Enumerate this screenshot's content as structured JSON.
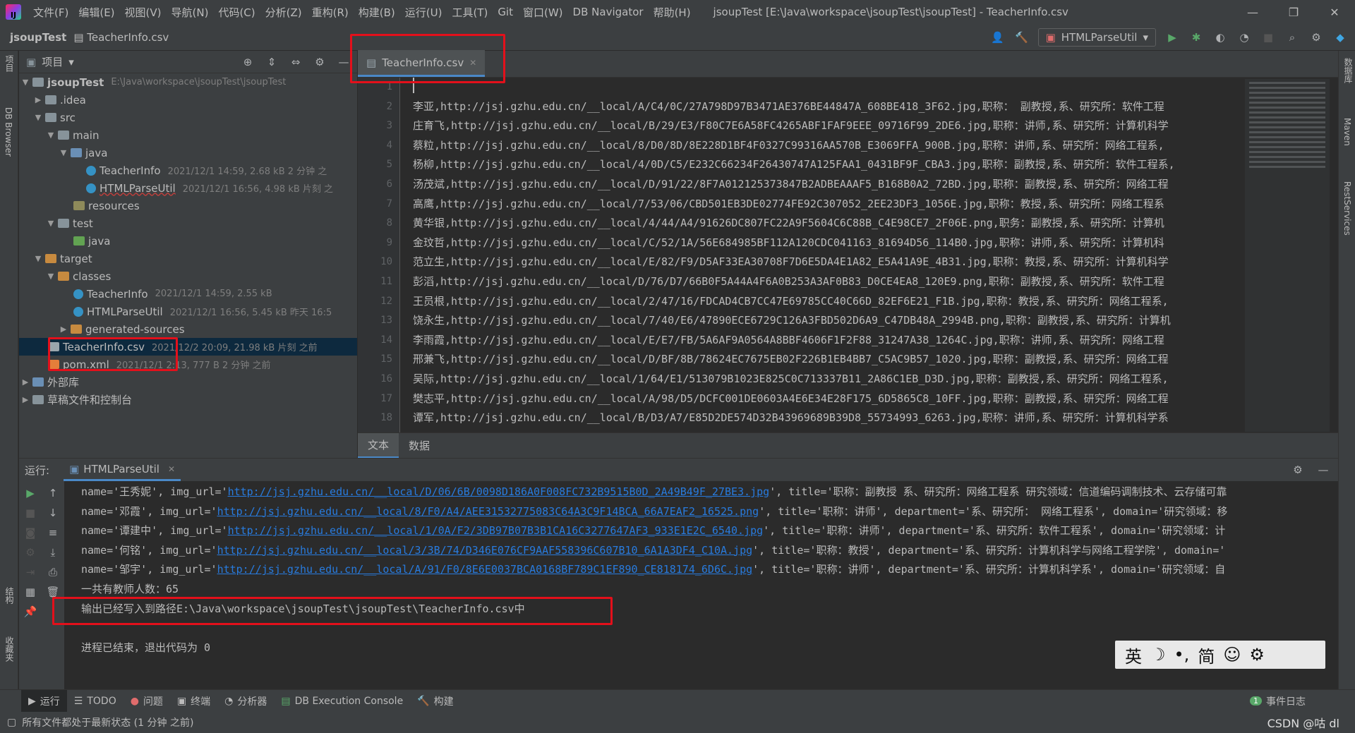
{
  "menubar": {
    "menus": [
      "文件(F)",
      "编辑(E)",
      "视图(V)",
      "导航(N)",
      "代码(C)",
      "分析(Z)",
      "重构(R)",
      "构建(B)",
      "运行(U)",
      "工具(T)",
      "Git",
      "窗口(W)",
      "DB Navigator",
      "帮助(H)"
    ],
    "window_title": "jsoupTest [E:\\Java\\workspace\\jsoupTest\\jsoupTest] - TeacherInfo.csv",
    "logo": "IJ"
  },
  "navbar": {
    "project": "jsoupTest",
    "file": "TeacherInfo.csv",
    "run_config": "HTMLParseUtil"
  },
  "left_strip": {
    "project_label": "项目",
    "db_browser": "DB Browser",
    "structure": "结构",
    "favorites": "收藏夹"
  },
  "right_strip": {
    "database": "数据库",
    "maven": "Maven",
    "rest": "RestServices"
  },
  "project_panel": {
    "title": "项目",
    "root_name": "jsoupTest",
    "root_path": "E:\\Java\\workspace\\jsoupTest\\jsoupTest",
    "nodes": {
      "idea": ".idea",
      "src": "src",
      "main": "main",
      "java": "java",
      "teacherinfo": "TeacherInfo",
      "teacherinfo_meta": "2021/12/1 14:59, 2.68 kB 2 分钟 之",
      "htmlparseutil": "HTMLParseUtil",
      "htmlparseutil_meta": "2021/12/1 16:56, 4.98 kB 片刻 之",
      "resources": "resources",
      "test": "test",
      "test_java": "java",
      "target": "target",
      "classes": "classes",
      "cls_teacherinfo": "TeacherInfo",
      "cls_teacherinfo_meta": "2021/12/1 14:59, 2.55 kB",
      "cls_htmlparseutil": "HTMLParseUtil",
      "cls_htmlparseutil_meta": "2021/12/1 16:56, 5.45 kB 昨天 16:5",
      "generated": "generated-sources",
      "csv": "TeacherInfo.csv",
      "csv_meta": "2021/12/2 20:09, 21.98 kB 片刻 之前",
      "pom": "pom.xml",
      "pom_meta": "2021/12/1 2:13, 777 B 2 分钟 之前",
      "external": "外部库",
      "scratches": "草稿文件和控制台"
    }
  },
  "editor": {
    "tab": "TeacherInfo.csv",
    "bottom_tabs": [
      "文本",
      "数据"
    ],
    "lines": [
      "",
      "李亚,http://jsj.gzhu.edu.cn/__local/A/C4/0C/27A798D97B3471AE376BE44847A_608BE418_3F62.jpg,职称： 副教授,系、研究所：软件工程",
      "庄育飞,http://jsj.gzhu.edu.cn/__local/B/29/E3/F80C7E6A58FC4265ABF1FAF9EEE_09716F99_2DE6.jpg,职称：讲师,系、研究所：计算机科学",
      "蔡粒,http://jsj.gzhu.edu.cn/__local/8/D0/8D/8E228D1BF4F0327C99316AA570B_E3069FFA_900B.jpg,职称：讲师,系、研究所：网络工程系,",
      "杨柳,http://jsj.gzhu.edu.cn/__local/4/0D/C5/E232C66234F26430747A125FAA1_0431BF9F_CBA3.jpg,职称：副教授,系、研究所：软件工程系,",
      "汤茂斌,http://jsj.gzhu.edu.cn/__local/D/91/22/8F7A012125373847B2ADBEAAAF5_B168B0A2_72BD.jpg,职称：副教授,系、研究所：网络工程",
      "高鹰,http://jsj.gzhu.edu.cn/__local/7/53/06/CBD501EB3DE02774FE92C307052_2EE23DF3_1056E.jpg,职称：教授,系、研究所：网络工程系",
      "黄华银,http://jsj.gzhu.edu.cn/__local/4/44/A4/91626DC807FC22A9F5604C6C88B_C4E98CE7_2F06E.png,职务：副教授,系、研究所：计算机",
      "金玟哲,http://jsj.gzhu.edu.cn/__local/C/52/1A/56E684985BF112A120CDC041163_81694D56_114B0.jpg,职称：讲师,系、研究所：计算机科",
      "范立生,http://jsj.gzhu.edu.cn/__local/E/82/F9/D5AF33EA30708F7D6E5DA4E1A82_E5A41A9E_4B31.jpg,职称：教授,系、研究所：计算机科学",
      "彭滔,http://jsj.gzhu.edu.cn/__local/D/76/D7/66B0F5A44A4F6A0B253A3AF0B83_D0CE4EA8_120E9.png,职称：副教授,系、研究所：软件工程",
      "王员根,http://jsj.gzhu.edu.cn/__local/2/47/16/FDCAD4CB7CC47E69785CC40C66D_82EF6E21_F1B.jpg,职称：教授,系、研究所：网络工程系,",
      "饶永生,http://jsj.gzhu.edu.cn/__local/7/40/E6/47890ECE6729C126A3FBD502D6A9_C47DB48A_2994B.png,职称：副教授,系、研究所：计算机",
      "李雨霞,http://jsj.gzhu.edu.cn/__local/E/E7/FB/5A6AF9A0564A8BBF4606F1F2F88_31247A38_1264C.jpg,职称：讲师,系、研究所：网络工程",
      "邢兼飞,http://jsj.gzhu.edu.cn/__local/D/BF/8B/78624EC7675EB02F226B1EB4BB7_C5AC9B57_1020.jpg,职称：副教授,系、研究所：网络工程",
      "吴际,http://jsj.gzhu.edu.cn/__local/1/64/E1/513079B1023E825C0C713337B11_2A86C1EB_D3D.jpg,职称：副教授,系、研究所：网络工程系,",
      "樊志平,http://jsj.gzhu.edu.cn/__local/A/98/D5/DCFC001DE0603A4E6E34E28F175_6D5865C8_10FF.jpg,职称：副教授,系、研究所：网络工程",
      "谭军,http://jsj.gzhu.edu.cn/__local/B/D3/A7/E85D2DE574D32B43969689B39D8_55734993_6263.jpg,职称：讲师,系、研究所：计算机科学系"
    ]
  },
  "run_panel": {
    "label": "运行:",
    "tab": "HTMLParseUtil",
    "console": [
      {
        "pre": "name='王秀妮', img_url='",
        "link": "http://jsj.gzhu.edu.cn/__local/D/06/6B/0098D186A0F008FC732B9515B0D_2A49B49F_27BE3.jpg",
        "post": "', title='职称：副教授 系、研究所：网络工程系 研究领域：信道编码调制技术、云存储可靠"
      },
      {
        "pre": "name='邓霞', img_url='",
        "link": "http://jsj.gzhu.edu.cn/__local/8/F0/A4/AEE31532775083C64A3C9F14BCA_66A7EAF2_16525.png",
        "post": "', title='职称：讲师', department='系、研究所： 网络工程系', domain='研究领域：移"
      },
      {
        "pre": "name='谭建中', img_url='",
        "link": "http://jsj.gzhu.edu.cn/__local/1/0A/F2/3DB97B07B3B1CA16C3277647AF3_933E1E2C_6540.jpg",
        "post": "', title='职称：讲师', department='系、研究所：软件工程系', domain='研究领域：计"
      },
      {
        "pre": "name='何铭', img_url='",
        "link": "http://jsj.gzhu.edu.cn/__local/3/3B/74/D346E076CF9AAF558396C607B10_6A1A3DF4_C10A.jpg",
        "post": "', title='职称：教授', department='系、研究所：计算机科学与网络工程学院', domain='"
      },
      {
        "pre": "name='邹宇', img_url='",
        "link": "http://jsj.gzhu.edu.cn/__local/A/91/F0/8E6E0037BCA0168BF789C1EF890_CE818174_6D6C.jpg",
        "post": "', title='职称：讲师', department='系、研究所：计算机科学系', domain='研究领域：自"
      },
      {
        "pre": "一共有教师人数：65",
        "link": "",
        "post": ""
      },
      {
        "pre": "输出已经写入到路径E:\\Java\\workspace\\jsoupTest\\jsoupTest\\TeacherInfo.csv中",
        "link": "",
        "post": ""
      },
      {
        "pre": "",
        "link": "",
        "post": ""
      },
      {
        "pre": "进程已结束，退出代码为 0",
        "link": "",
        "post": ""
      }
    ]
  },
  "ime": {
    "items": [
      "英",
      "☽",
      "•,",
      "简",
      "☺",
      "⚙"
    ]
  },
  "bottom_tabs": [
    "运行",
    "TODO",
    "问题",
    "终端",
    "分析器",
    "DB Execution Console",
    "构建"
  ],
  "event_log": "事件日志",
  "event_count": "1",
  "status_text": "所有文件都处于最新状态 (1 分钟 之前)",
  "watermark": "CSDN @咕 dl"
}
